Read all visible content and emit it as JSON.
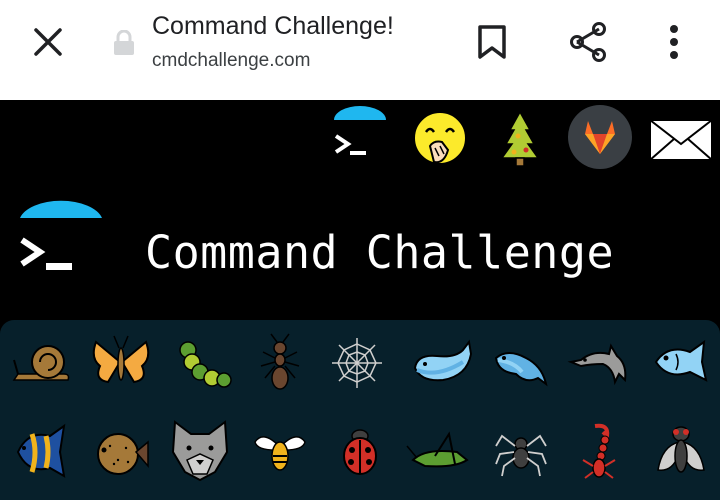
{
  "toolbar": {
    "title": "Command Challenge!",
    "url": "cmdchallenge.com",
    "icons": [
      "close-icon",
      "lock-icon",
      "bookmark-icon",
      "share-icon",
      "more-vert-icon"
    ]
  },
  "page": {
    "title": "Command Challenge",
    "header_icons": [
      "cmd-logo-icon",
      "face-with-hand-over-mouth-icon",
      "christmas-tree-icon",
      "gitlab-icon",
      "envelope-icon"
    ],
    "emoji_row1": [
      "snail-icon",
      "butterfly-icon",
      "caterpillar-icon",
      "ant-icon",
      "spider-web-icon",
      "whale-icon",
      "spouting-whale-icon",
      "dolphin-icon",
      "fish-icon"
    ],
    "emoji_row2": [
      "tropical-fish-icon",
      "blowfish-icon",
      "wolf-icon",
      "bee-icon",
      "ladybug-icon",
      "cricket-icon",
      "spider-icon",
      "scorpion-icon",
      "fly-icon"
    ]
  },
  "colors": {
    "logo_accent": "#1fb7ef",
    "panel_bg": "#07202b",
    "gitlab_orange": "#e2432a"
  }
}
